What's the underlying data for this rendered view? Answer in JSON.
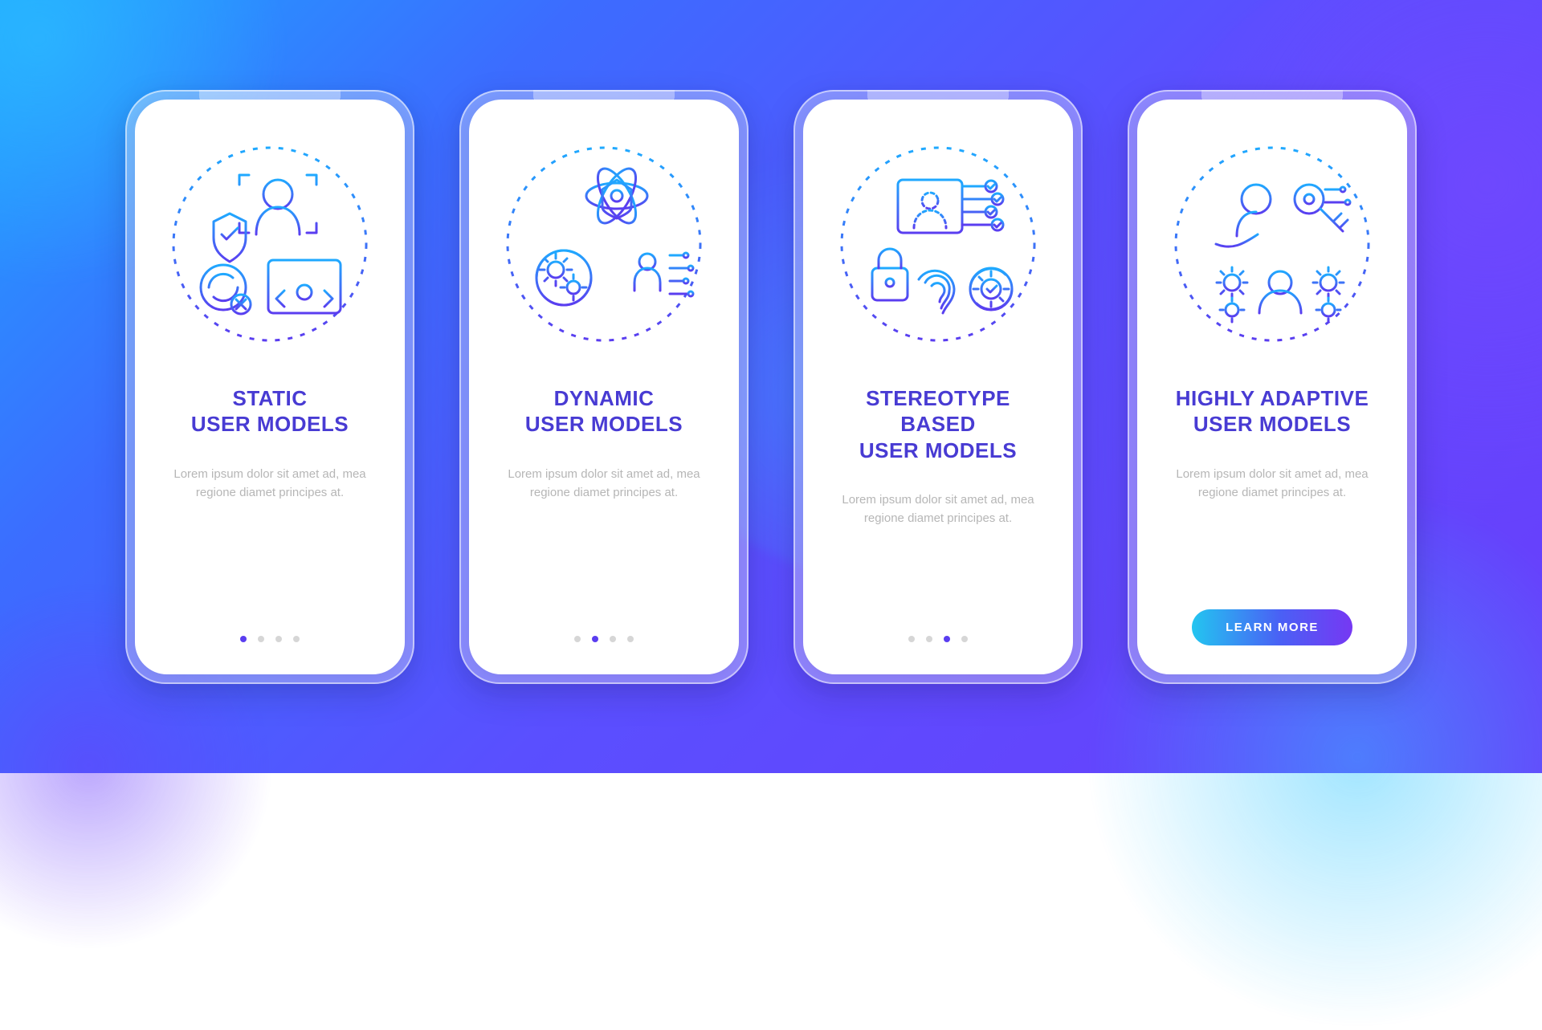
{
  "placeholder_body": "Lorem ipsum dolor sit amet ad, mea regione diamet principes at.",
  "cta_label": "LEARN MORE",
  "slides": [
    {
      "title": "STATIC\nUSER MODELS",
      "active_index": 0,
      "icon": "static-models-icon"
    },
    {
      "title": "DYNAMIC\nUSER MODELS",
      "active_index": 1,
      "icon": "dynamic-models-icon"
    },
    {
      "title": "STEREOTYPE BASED\nUSER MODELS",
      "active_index": 2,
      "icon": "stereotype-models-icon"
    },
    {
      "title": "HIGHLY ADAPTIVE\nUSER MODELS",
      "active_index": 3,
      "icon": "adaptive-models-icon"
    }
  ],
  "slide_count": 4,
  "colors": {
    "stroke_top": "#1fa9ff",
    "stroke_bottom": "#5a3df0"
  }
}
